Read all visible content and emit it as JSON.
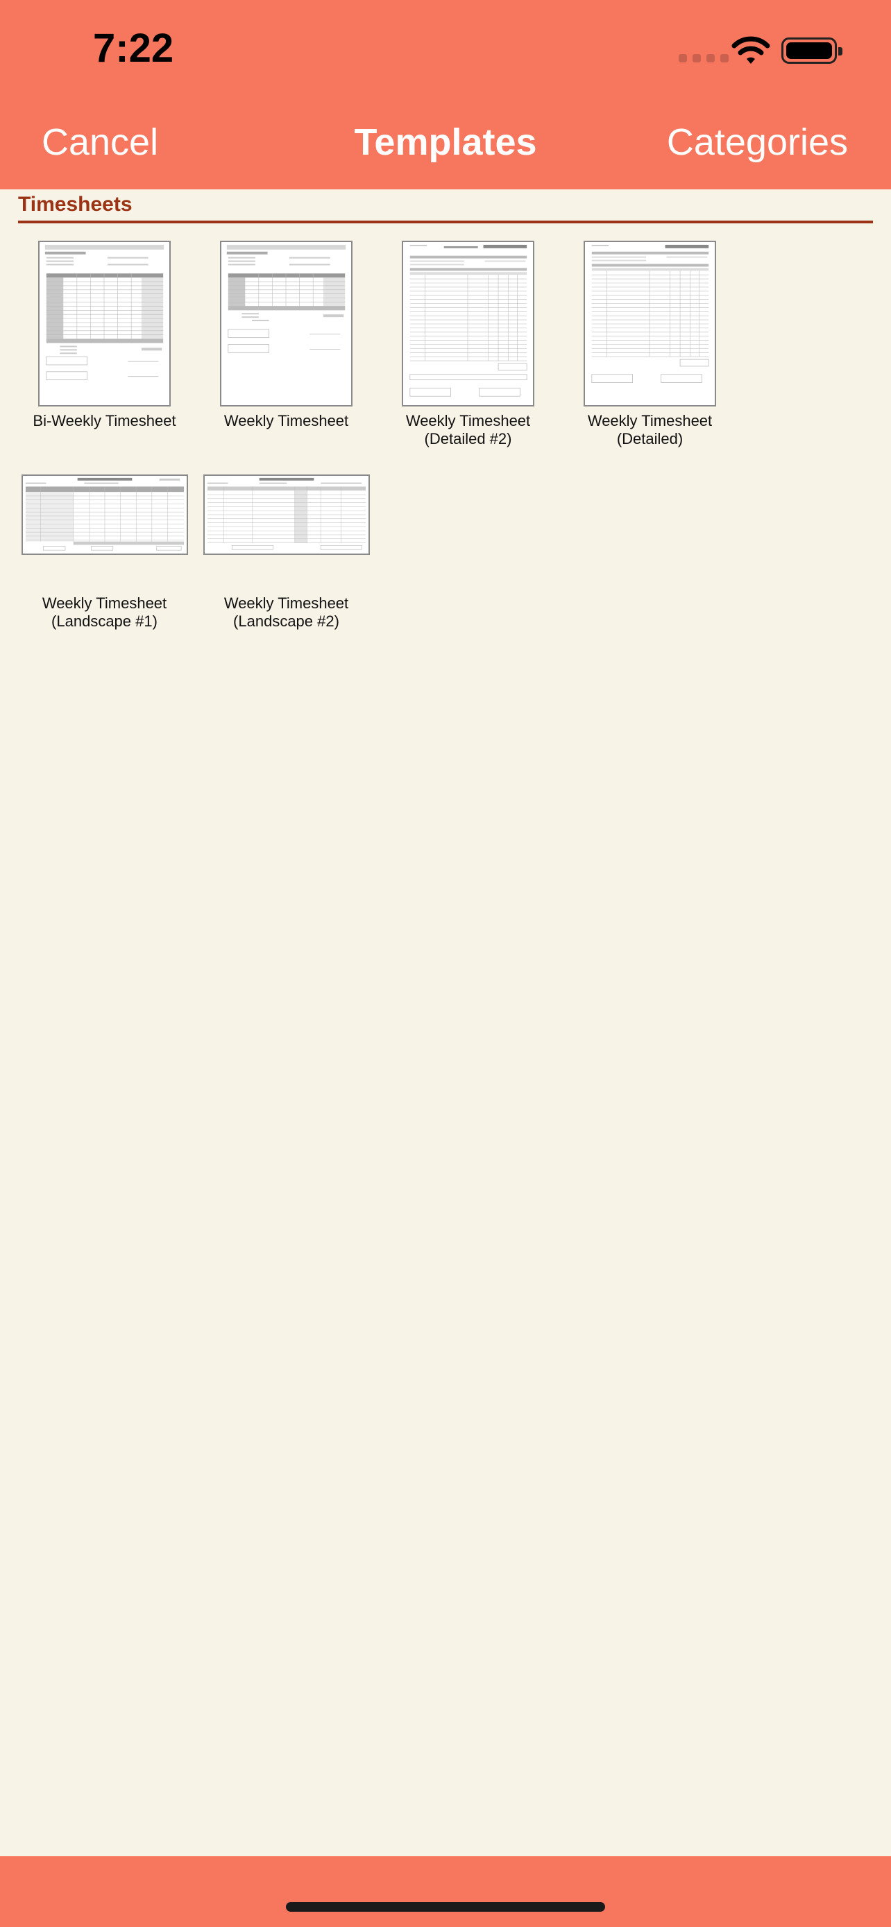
{
  "status": {
    "time": "7:22"
  },
  "nav": {
    "cancel": "Cancel",
    "title": "Templates",
    "categories": "Categories"
  },
  "section": {
    "title": "Timesheets"
  },
  "templates": [
    {
      "line1": "Bi-Weekly Timesheet",
      "line2": ""
    },
    {
      "line1": "Weekly Timesheet",
      "line2": ""
    },
    {
      "line1": "Weekly Timesheet",
      "line2": "(Detailed #2)"
    },
    {
      "line1": "Weekly Timesheet",
      "line2": "(Detailed)"
    },
    {
      "line1": "Weekly Timesheet",
      "line2": "(Landscape #1)"
    },
    {
      "line1": "Weekly Timesheet",
      "line2": "(Landscape #2)"
    }
  ],
  "colors": {
    "bar": "#f7765e",
    "background": "#f8f3e7",
    "accent": "#9a3414"
  }
}
